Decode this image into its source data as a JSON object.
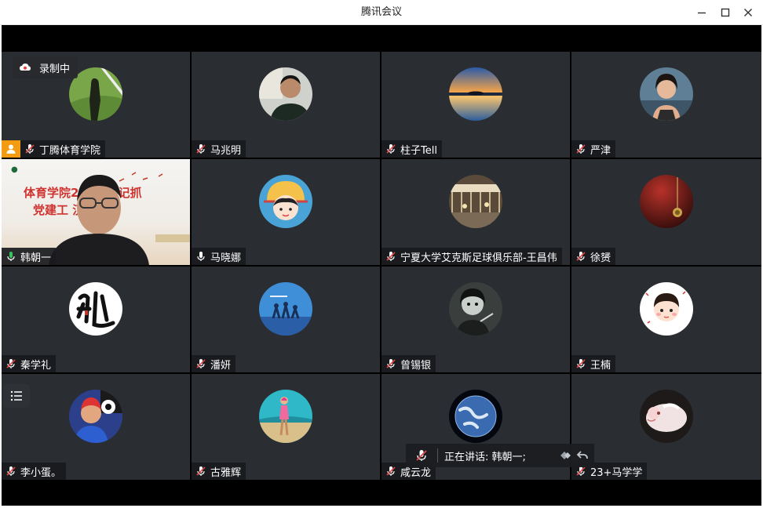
{
  "window": {
    "title": "腾讯会议"
  },
  "recording": {
    "label": "录制中"
  },
  "speaking": {
    "label": "正在讲话: 韩朝一;"
  },
  "colors": {
    "host_badge": "#f39c12",
    "active_border": "#37c35e",
    "mic_muted": "#e04545"
  },
  "video": {
    "banner_line1": "体育学院2   支部书记抓",
    "banner_line2": "党建工    汉考核会"
  },
  "participants": [
    {
      "name": "丁腾体育学院",
      "mic": "muted",
      "host": true,
      "avatar": "field-photo"
    },
    {
      "name": "马兆明",
      "mic": "muted",
      "avatar": "man-photo"
    },
    {
      "name": "柱子Tell",
      "mic": "muted",
      "avatar": "sunset-lake"
    },
    {
      "name": "严津",
      "mic": "muted",
      "avatar": "woman-photo"
    },
    {
      "name": "韩朝一",
      "mic": "on",
      "video": true
    },
    {
      "name": "马晓娜",
      "mic": "on",
      "avatar": "cartoon-girl"
    },
    {
      "name": "宁夏大学艾克斯足球俱乐部-王昌伟",
      "mic": "muted",
      "avatar": "station-photo"
    },
    {
      "name": "徐赟",
      "mic": "muted",
      "avatar": "red-pendant"
    },
    {
      "name": "秦学礼",
      "mic": "muted",
      "avatar": "calligraphy"
    },
    {
      "name": "潘妍",
      "mic": "muted",
      "avatar": "blue-poster"
    },
    {
      "name": "曾锡银",
      "mic": "muted",
      "avatar": "girl-photo"
    },
    {
      "name": "王楠",
      "mic": "muted",
      "avatar": "cartoon-boy"
    },
    {
      "name": "李小蛋。",
      "mic": "muted",
      "avatar": "boy-photo"
    },
    {
      "name": "古雅辉",
      "mic": "muted",
      "avatar": "beach-photo"
    },
    {
      "name": "咸云龙",
      "mic": "muted",
      "avatar": "earth-photo"
    },
    {
      "name": "23+马学学",
      "mic": "muted",
      "avatar": "cat-photo"
    }
  ]
}
